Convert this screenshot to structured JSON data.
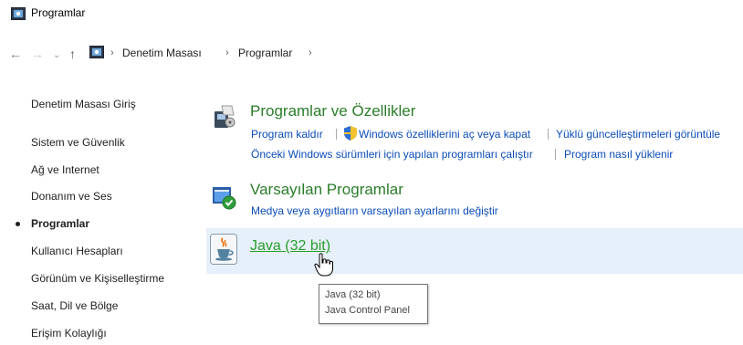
{
  "window": {
    "title": "Programlar"
  },
  "breadcrumb": {
    "items": [
      "Denetim Masası",
      "Programlar"
    ]
  },
  "sidebar": {
    "items": [
      {
        "label": "Denetim Masası Giriş"
      },
      {
        "label": "Sistem ve Güvenlik"
      },
      {
        "label": "Ağ ve Internet"
      },
      {
        "label": "Donanım ve Ses"
      },
      {
        "label": "Programlar",
        "active": true
      },
      {
        "label": "Kullanıcı Hesapları"
      },
      {
        "label": "Görünüm ve Kişiselleştirme"
      },
      {
        "label": "Saat, Dil ve Bölge"
      },
      {
        "label": "Erişim Kolaylığı"
      }
    ]
  },
  "categories": {
    "programs_features": {
      "title": "Programlar ve Özellikler",
      "links": [
        "Program kaldır",
        "Windows özelliklerini aç veya kapat",
        "Yüklü güncelleştirmeleri görüntüle",
        "Önceki Windows sürümleri için yapılan programları çalıştır",
        "Program nasıl yüklenir"
      ]
    },
    "default_programs": {
      "title": "Varsayılan Programlar",
      "links": [
        "Medya veya aygıtların varsayılan ayarlarını değiştir"
      ]
    },
    "java": {
      "title": "Java (32 bit)"
    }
  },
  "tooltip": {
    "line1": "Java (32 bit)",
    "line2": "Java Control Panel"
  },
  "colors": {
    "category_title": "#2a7d2a",
    "link": "#0b4cb8",
    "hover_row": "#e6f0fa"
  }
}
